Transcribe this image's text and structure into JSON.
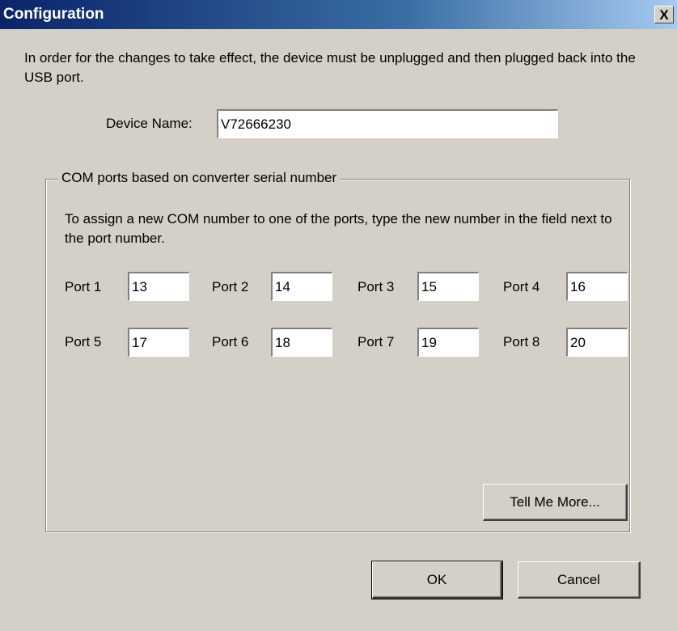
{
  "window": {
    "title": "Configuration",
    "close_glyph": "X"
  },
  "info_text": "In order for the changes to take effect, the device must be unplugged and then plugged back into the USB port.",
  "device": {
    "label": "Device Name:",
    "value": "V72666230"
  },
  "com_group": {
    "legend": "COM ports based on converter serial number",
    "description": "To assign a new COM number to one of the ports, type the new number in the field next to the port number.",
    "ports": [
      {
        "label": "Port 1",
        "value": "13"
      },
      {
        "label": "Port 2",
        "value": "14"
      },
      {
        "label": "Port 3",
        "value": "15"
      },
      {
        "label": "Port 4",
        "value": "16"
      },
      {
        "label": "Port 5",
        "value": "17"
      },
      {
        "label": "Port 6",
        "value": "18"
      },
      {
        "label": "Port 7",
        "value": "19"
      },
      {
        "label": "Port 8",
        "value": "20"
      }
    ],
    "tell_more_label": "Tell Me More..."
  },
  "buttons": {
    "ok_label": "OK",
    "cancel_label": "Cancel"
  }
}
